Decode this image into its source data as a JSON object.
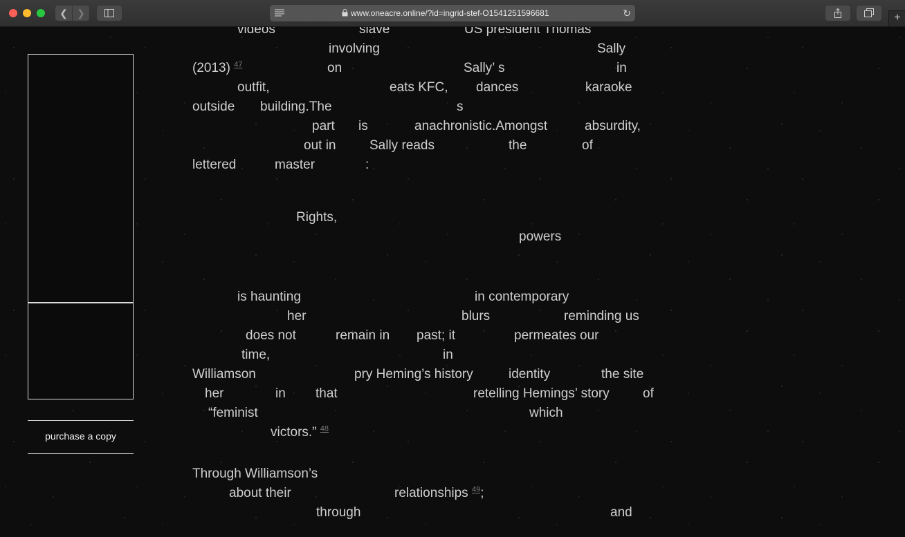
{
  "browser": {
    "url": "www.oneacre.online/?id=ingrid-stef-O1541251596681",
    "icons": {
      "back": "chevron-left-icon",
      "forward": "chevron-right-icon",
      "sidebar": "sidebar-icon",
      "reader": "reader-icon",
      "lock": "lock-icon",
      "reload": "reload-icon",
      "share": "share-icon",
      "tabs": "tabs-icon",
      "new_tab": "plus-icon"
    },
    "traffic_colors": {
      "close": "#fe5f57",
      "minimize": "#febc2e",
      "zoom": "#28c840"
    }
  },
  "sidebar": {
    "purchase_label": "purchase a copy"
  },
  "article": {
    "lines": [
      [
        "videos",
        "slave",
        "US president Thomas"
      ],
      [
        "involving",
        "Sally"
      ],
      [
        "(2013)",
        "on",
        "Sally’ s",
        "in"
      ],
      [
        "outfit,",
        "eats KFC,",
        "dances",
        "karaoke"
      ],
      [
        "outside",
        "building.The",
        "s"
      ],
      [
        "part",
        "is",
        "anachronistic.Amongst",
        "absurdity,"
      ],
      [
        "out in",
        "Sally reads",
        "the",
        "of"
      ],
      [
        "lettered",
        "master",
        ":"
      ],
      [
        "Rights,"
      ],
      [
        "powers"
      ],
      [
        "is haunting",
        "in contemporary"
      ],
      [
        "her",
        "blurs",
        "reminding us"
      ],
      [
        "does not",
        "remain in",
        "past; it",
        "permeates our"
      ],
      [
        "time,",
        "in"
      ],
      [
        "Williamson",
        "pry Heming’s history",
        "identity",
        "the site"
      ],
      [
        "her",
        "in",
        "that",
        "retelling Hemings’ story",
        "of"
      ],
      [
        "“feminist",
        "which"
      ],
      [
        "victors.”"
      ],
      [
        "Through Williamson’s"
      ],
      [
        "about their",
        "relationships",
        ";"
      ],
      [
        "through",
        "and"
      ]
    ],
    "footnotes": {
      "fn47": "47",
      "fn48": "48",
      "fn49": "49"
    }
  }
}
